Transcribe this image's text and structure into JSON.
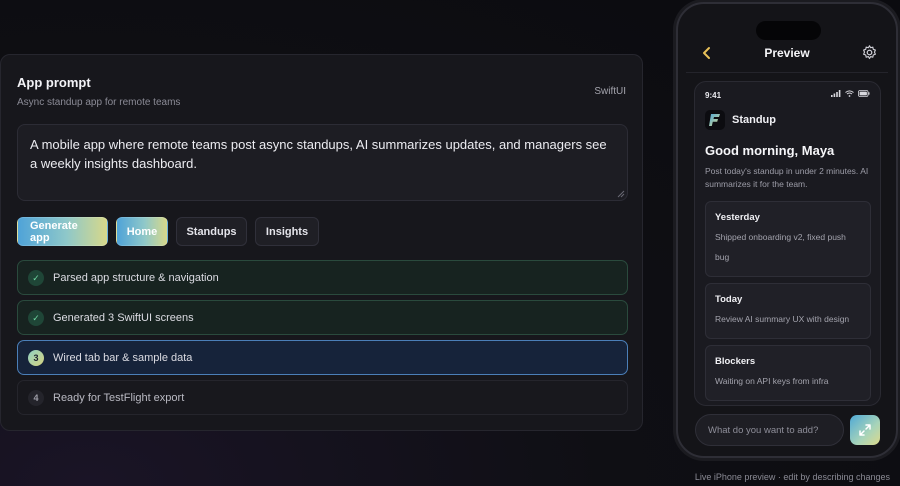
{
  "panel": {
    "title": "App prompt",
    "subtitle": "Async standup app for remote teams",
    "platform_tag": "SwiftUI",
    "prompt_text": "A mobile app where remote teams post async standups, AI summarizes updates, and managers see a weekly insights dashboard."
  },
  "buttons": {
    "generate": "Generate app",
    "home": "Home",
    "standups": "Standups",
    "insights": "Insights"
  },
  "steps": [
    {
      "marker": "✓",
      "label": "Parsed app structure & navigation",
      "state": "done"
    },
    {
      "marker": "✓",
      "label": "Generated 3 SwiftUI screens",
      "state": "done"
    },
    {
      "marker": "3",
      "label": "Wired tab bar & sample data",
      "state": "active"
    },
    {
      "marker": "4",
      "label": "Ready for TestFlight export",
      "state": "pending"
    }
  ],
  "phone": {
    "nav_title": "Preview",
    "status_time": "9:41",
    "app_name": "Standup",
    "greeting": "Good morning, Maya",
    "intro": "Post today's standup in under 2 minutes. AI summarizes it for the team.",
    "cards": {
      "yesterday": {
        "title": "Yesterday",
        "body": "Shipped onboarding v2, fixed push bug"
      },
      "today": {
        "title": "Today",
        "body": "Review AI summary UX with design"
      },
      "blockers": {
        "title": "Blockers",
        "body": "Waiting on API keys from infra"
      }
    },
    "composer_placeholder": "What do you want to add?"
  },
  "footer": "Live iPhone preview · edit by describing changes",
  "colors": {
    "accent_gradient_start": "#4fa3d8",
    "accent_gradient_end": "#d7d88a",
    "done_green": "#6fd6a1",
    "active_blue": "#4b7fb8",
    "back_chevron": "#e8c15a"
  }
}
